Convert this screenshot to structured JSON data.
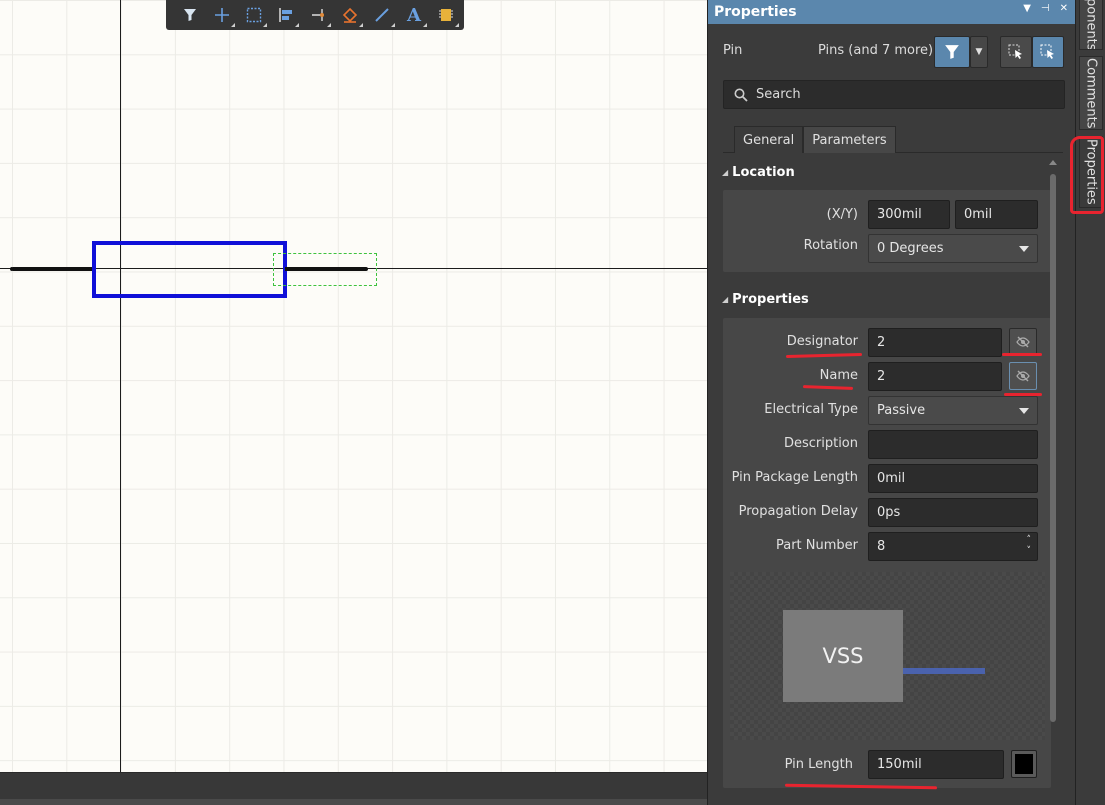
{
  "toolbar": {
    "buttons": [
      "filter-icon",
      "add-icon",
      "select-rect-icon",
      "align-icon",
      "wire-icon",
      "fill-icon",
      "line-icon",
      "text-icon",
      "component-icon"
    ]
  },
  "panel": {
    "title": "Properties",
    "selection_kind": "Pin",
    "selection_desc": "Pins (and 7 more)",
    "search_placeholder": "Search",
    "tabs": [
      "General",
      "Parameters"
    ],
    "location": {
      "header": "Location",
      "xy_label": "(X/Y)",
      "x": "300mil",
      "y": "0mil",
      "rotation_label": "Rotation",
      "rotation": "0 Degrees"
    },
    "properties": {
      "header": "Properties",
      "designator_label": "Designator",
      "designator": "2",
      "name_label": "Name",
      "name": "2",
      "electrical_type_label": "Electrical Type",
      "electrical_type": "Passive",
      "description_label": "Description",
      "description": "",
      "pin_package_length_label": "Pin Package Length",
      "pin_package_length": "0mil",
      "propagation_delay_label": "Propagation Delay",
      "propagation_delay": "0ps",
      "part_number_label": "Part Number",
      "part_number": "8",
      "preview_text": "VSS",
      "pin_length_label": "Pin Length",
      "pin_length": "150mil"
    }
  },
  "side_tabs": [
    "ponents",
    "Comments",
    "Properties"
  ],
  "colors": {
    "accent": "#5b87ad",
    "component_outline": "#1010d8",
    "annotation": "#e8242f"
  }
}
